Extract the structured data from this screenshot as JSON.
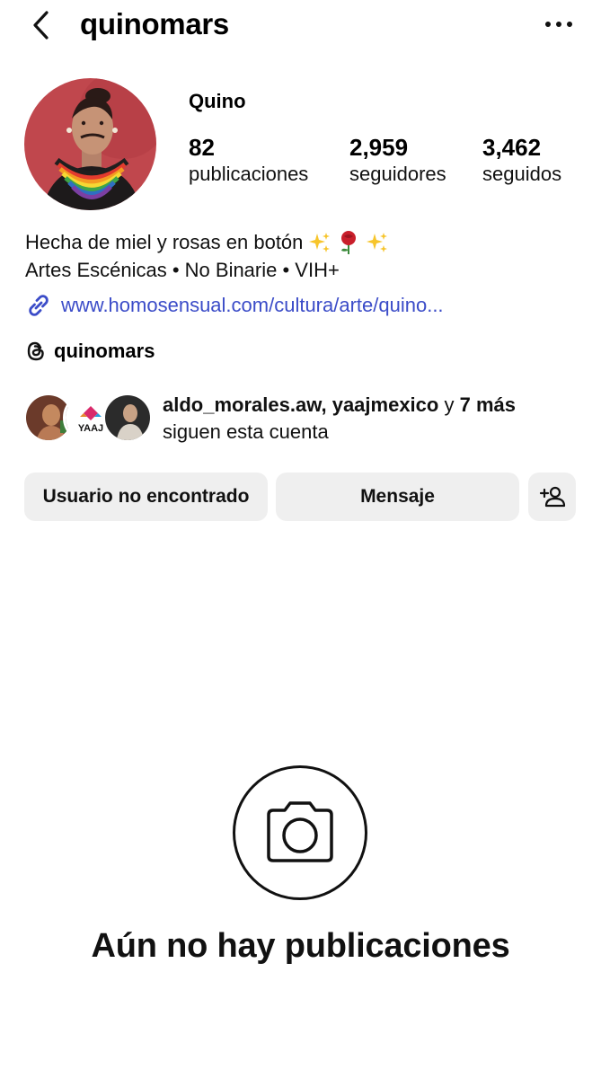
{
  "header": {
    "username": "quinomars",
    "back_icon": "chevron-left-icon",
    "more_icon": "more-horizontal-icon"
  },
  "profile": {
    "display_name": "Quino",
    "stats": [
      {
        "value": "82",
        "label": "publicaciones"
      },
      {
        "value": "2,959",
        "label": "seguidores"
      },
      {
        "value": "3,462",
        "label": "seguidos"
      }
    ],
    "bio_line_1": "Hecha de miel y rosas en botón",
    "bio_line_1_emojis": [
      "sparkles-icon",
      "rose-icon",
      "sparkles-icon"
    ],
    "bio_line_2": "Artes Escénicas • No Binarie • VIH+",
    "link": "www.homosensual.com/cultura/arte/quino...",
    "threads_handle": "quinomars"
  },
  "followed_by": {
    "names": "aldo_morales.aw, yaajmexico",
    "connector": " y ",
    "more": "7 más",
    "subtitle": "siguen esta cuenta",
    "avatar_badge_text": "YAAJ"
  },
  "actions": {
    "primary_label": "Usuario no encontrado",
    "message_label": "Mensaje",
    "add_icon": "add-person-icon"
  },
  "empty_state": {
    "title": "Aún no hay publicaciones",
    "icon": "camera-icon"
  },
  "colors": {
    "link": "#3b4cc8",
    "button_bg": "#efefef",
    "avatar_bg": "#c0474d"
  }
}
